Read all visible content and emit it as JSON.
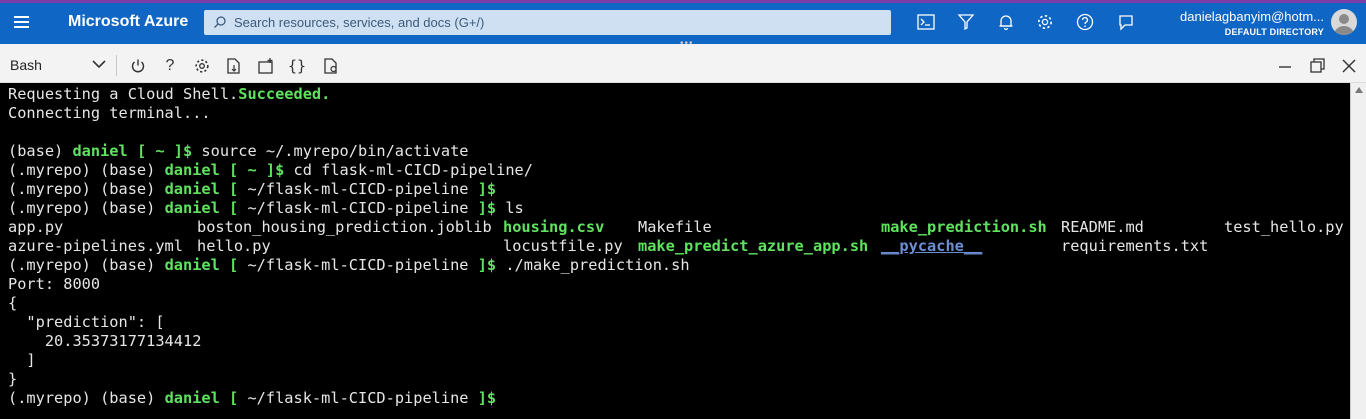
{
  "portal": {
    "brand": "Microsoft Azure",
    "search_placeholder": "Search resources, services, and docs (G+/)",
    "user_email": "danielagbanyim@hotm...",
    "user_directory": "DEFAULT DIRECTORY",
    "icons": [
      "menu-icon",
      "search-icon",
      "cloud-shell-icon",
      "directory-filter-icon",
      "notifications-icon",
      "settings-icon",
      "help-icon",
      "feedback-icon",
      "avatar"
    ]
  },
  "shell": {
    "selected_shell": "Bash",
    "toolbar_icons": [
      "power-icon",
      "help-icon",
      "settings-icon",
      "upload-download-icon",
      "new-session-icon",
      "editor-icon",
      "web-preview-icon"
    ],
    "window_icons": [
      "minimize-icon",
      "maximize-icon",
      "close-icon"
    ]
  },
  "terminal": {
    "l1a": "Requesting a Cloud Shell.",
    "l1b": "Succeeded.",
    "l2": "Connecting terminal...",
    "p_base": "(base) ",
    "p_repo": "(.myrepo) (base) ",
    "p_user": "daniel",
    "p_home_bracket": " [ ~ ]$",
    "p_dir_open": " [ ",
    "p_dir": "~/flask-ml-CICD-pipeline",
    "p_dir_close": " ]$",
    "cmd1": " source ~/.myrepo/bin/activate",
    "cmd2": " cd flask-ml-CICD-pipeline/",
    "cmd4": " ls",
    "cmd5": " ./make_prediction.sh",
    "ls_row1": [
      "app.py",
      "boston_housing_prediction.joblib",
      "housing.csv",
      "Makefile",
      "make_prediction.sh",
      "README.md",
      "test_hello.py"
    ],
    "ls_row2": [
      "azure-pipelines.yml",
      "hello.py",
      "locustfile.py",
      "make_predict_azure_app.sh",
      "__pycache__",
      "requirements.txt"
    ],
    "out_port": "Port: 8000",
    "out_open": "{",
    "out_key": "  \"prediction\": [",
    "out_val": "    20.35373177134412",
    "out_arr_close": "  ]",
    "out_close": "}"
  },
  "colors": {
    "portal_blue": "#1066c4",
    "accent_purple": "#7b3fa8",
    "terminal_green": "#5fe35f",
    "terminal_dir_blue": "#6c8fd4"
  }
}
